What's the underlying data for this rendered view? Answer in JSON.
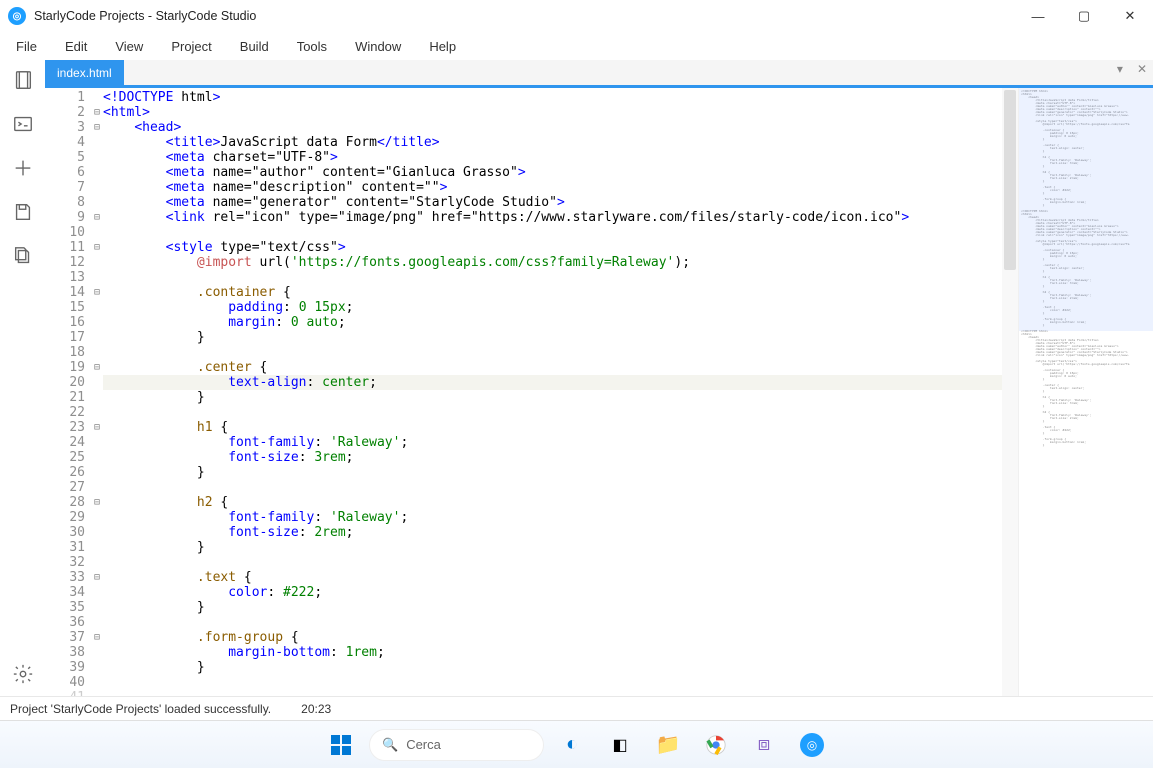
{
  "window": {
    "title": "StarlyCode Projects - StarlyCode Studio"
  },
  "menu": {
    "file": "File",
    "edit": "Edit",
    "view": "View",
    "project": "Project",
    "build": "Build",
    "tools": "Tools",
    "window": "Window",
    "help": "Help"
  },
  "tabs": {
    "active": "index.html"
  },
  "code": {
    "lines": [
      "<!DOCTYPE html>",
      "<html>",
      "    <head>",
      "        <title>JavaScript data Form</title>",
      "        <meta charset=\"UTF-8\">",
      "        <meta name=\"author\" content=\"Gianluca Grasso\">",
      "        <meta name=\"description\" content=\"\">",
      "        <meta name=\"generator\" content=\"StarlyCode Studio\">",
      "        <link rel=\"icon\" type=\"image/png\" href=\"https://www.starlyware.com/files/starly-code/icon.ico\">",
      "",
      "        <style type=\"text/css\">",
      "            @import url('https://fonts.googleapis.com/css?family=Raleway');",
      "",
      "            .container {",
      "                padding: 0 15px;",
      "                margin: 0 auto;",
      "            }",
      "",
      "            .center {",
      "                text-align: center;",
      "            }",
      "",
      "            h1 {",
      "                font-family: 'Raleway';",
      "                font-size: 3rem;",
      "            }",
      "",
      "            h2 {",
      "                font-family: 'Raleway';",
      "                font-size: 2rem;",
      "            }",
      "",
      "            .text {",
      "                color: #222;",
      "            }",
      "",
      "            .form-group {",
      "                margin-bottom: 1rem;",
      "            }",
      ""
    ],
    "highlighted_line_index": 19
  },
  "status": {
    "message": "Project 'StarlyCode Projects' loaded successfully.",
    "time": "20:23"
  },
  "taskbar": {
    "search_placeholder": "Cerca"
  }
}
